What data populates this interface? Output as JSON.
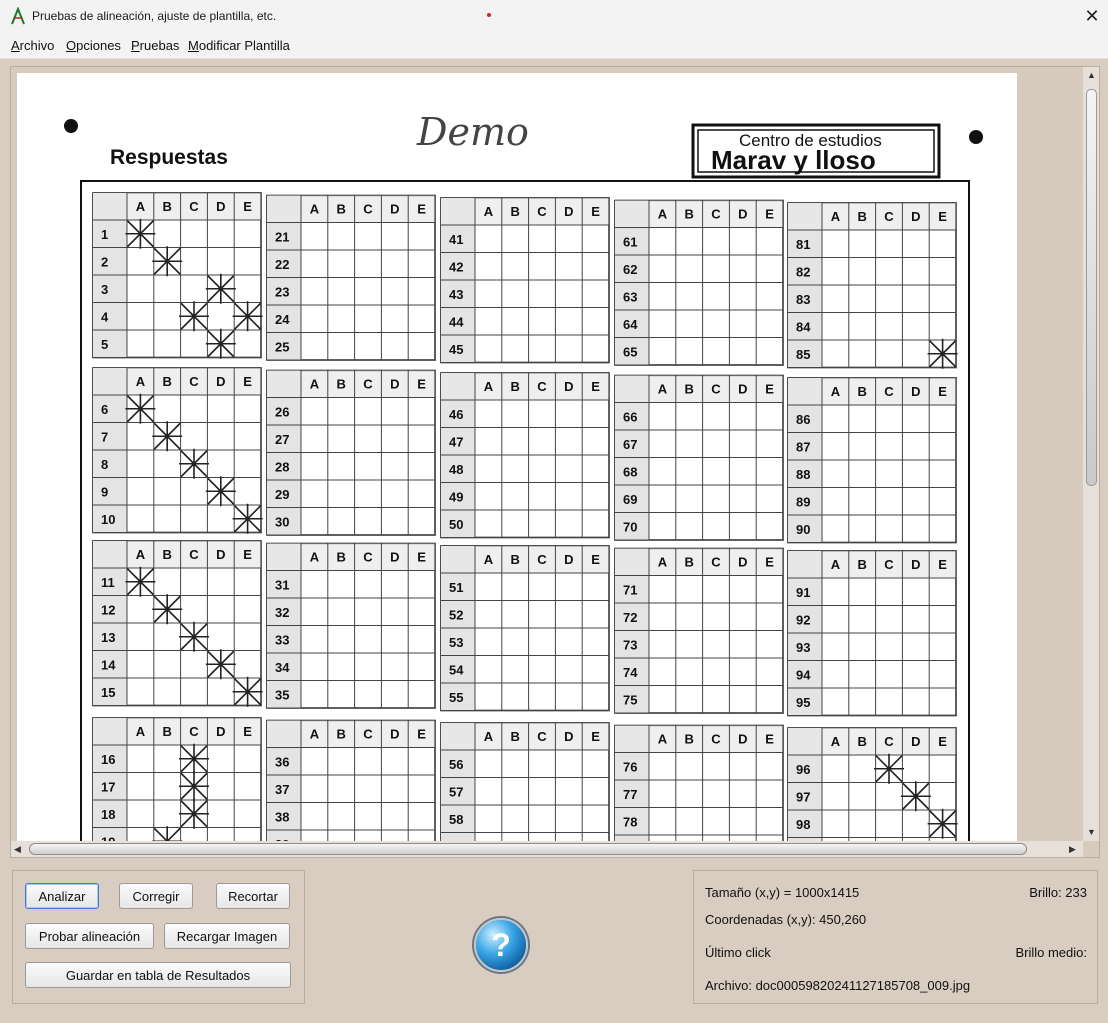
{
  "window": {
    "title": "Pruebas de alineación, ajuste de plantilla, etc.",
    "close": "✕"
  },
  "menu": [
    {
      "u": "A",
      "rest": "rchivo"
    },
    {
      "u": "O",
      "rest": "pciones"
    },
    {
      "u": "P",
      "rest": "ruebas"
    },
    {
      "u": "M",
      "rest": "odificar Plantilla"
    }
  ],
  "document": {
    "handwritten": "Demo",
    "heading": "Respuestas",
    "logo_top": "Centro de estudios",
    "logo_bottom": "Marav y lloso",
    "columns": [
      "A",
      "B",
      "C",
      "D",
      "E"
    ],
    "marks": [
      {
        "q": 1,
        "opt": "A"
      },
      {
        "q": 2,
        "opt": "B"
      },
      {
        "q": 3,
        "opt": "D"
      },
      {
        "q": 4,
        "opt": "C"
      },
      {
        "q": 4,
        "opt": "E"
      },
      {
        "q": 5,
        "opt": "D"
      },
      {
        "q": 6,
        "opt": "A"
      },
      {
        "q": 7,
        "opt": "B"
      },
      {
        "q": 8,
        "opt": "C"
      },
      {
        "q": 9,
        "opt": "D"
      },
      {
        "q": 10,
        "opt": "E"
      },
      {
        "q": 11,
        "opt": "A"
      },
      {
        "q": 12,
        "opt": "B"
      },
      {
        "q": 13,
        "opt": "C"
      },
      {
        "q": 14,
        "opt": "D"
      },
      {
        "q": 15,
        "opt": "E"
      },
      {
        "q": 16,
        "opt": "C"
      },
      {
        "q": 17,
        "opt": "C"
      },
      {
        "q": 18,
        "opt": "C"
      },
      {
        "q": 19,
        "opt": "B"
      },
      {
        "q": 85,
        "opt": "E"
      },
      {
        "q": 96,
        "opt": "C"
      },
      {
        "q": 97,
        "opt": "D"
      },
      {
        "q": 98,
        "opt": "E"
      }
    ]
  },
  "buttons": {
    "analizar": "Analizar",
    "corregir": "Corregir",
    "recortar": "Recortar",
    "probar": "Probar alineación",
    "recargar": "Recargar Imagen",
    "guardar": "Guardar en tabla de Resultados"
  },
  "help_symbol": "?",
  "info": {
    "size": "Tamaño (x,y) = 1000x1415",
    "brightness": "Brillo: 233",
    "coords": "Coordenadas (x,y): 450,260",
    "last_click": "Último click",
    "avg_brightness": "Brillo medio:",
    "file": "Archivo: doc0005982024112718570​8_009.jpg"
  }
}
